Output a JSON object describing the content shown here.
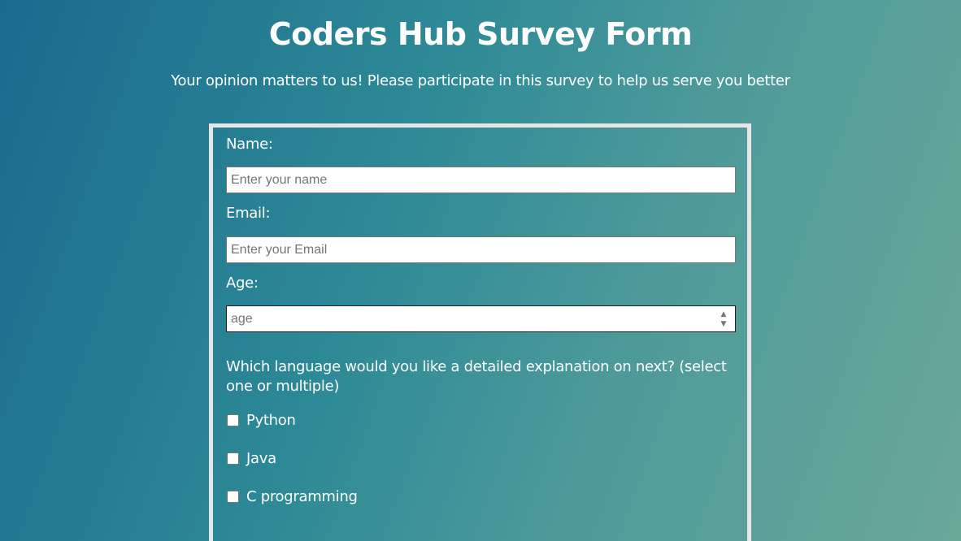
{
  "header": {
    "title": "Coders Hub Survey Form",
    "subtitle": "Your opinion matters to us! Please participate in this survey to help us serve you better"
  },
  "form": {
    "name": {
      "label": "Name:",
      "placeholder": "Enter your name",
      "value": ""
    },
    "email": {
      "label": "Email:",
      "placeholder": "Enter your Email",
      "value": ""
    },
    "age": {
      "label": "Age:",
      "placeholder": "age",
      "value": ""
    },
    "language_question": "Which language would you like a detailed explanation on next? (select one or multiple)",
    "languages": [
      {
        "label": "Python",
        "checked": false
      },
      {
        "label": "Java",
        "checked": false
      },
      {
        "label": "C programming",
        "checked": false
      }
    ]
  },
  "colors": {
    "background_start": "#1a6a8e",
    "background_end": "#6aa898",
    "form_border": "#e6e6e6",
    "text": "#ffffff"
  }
}
